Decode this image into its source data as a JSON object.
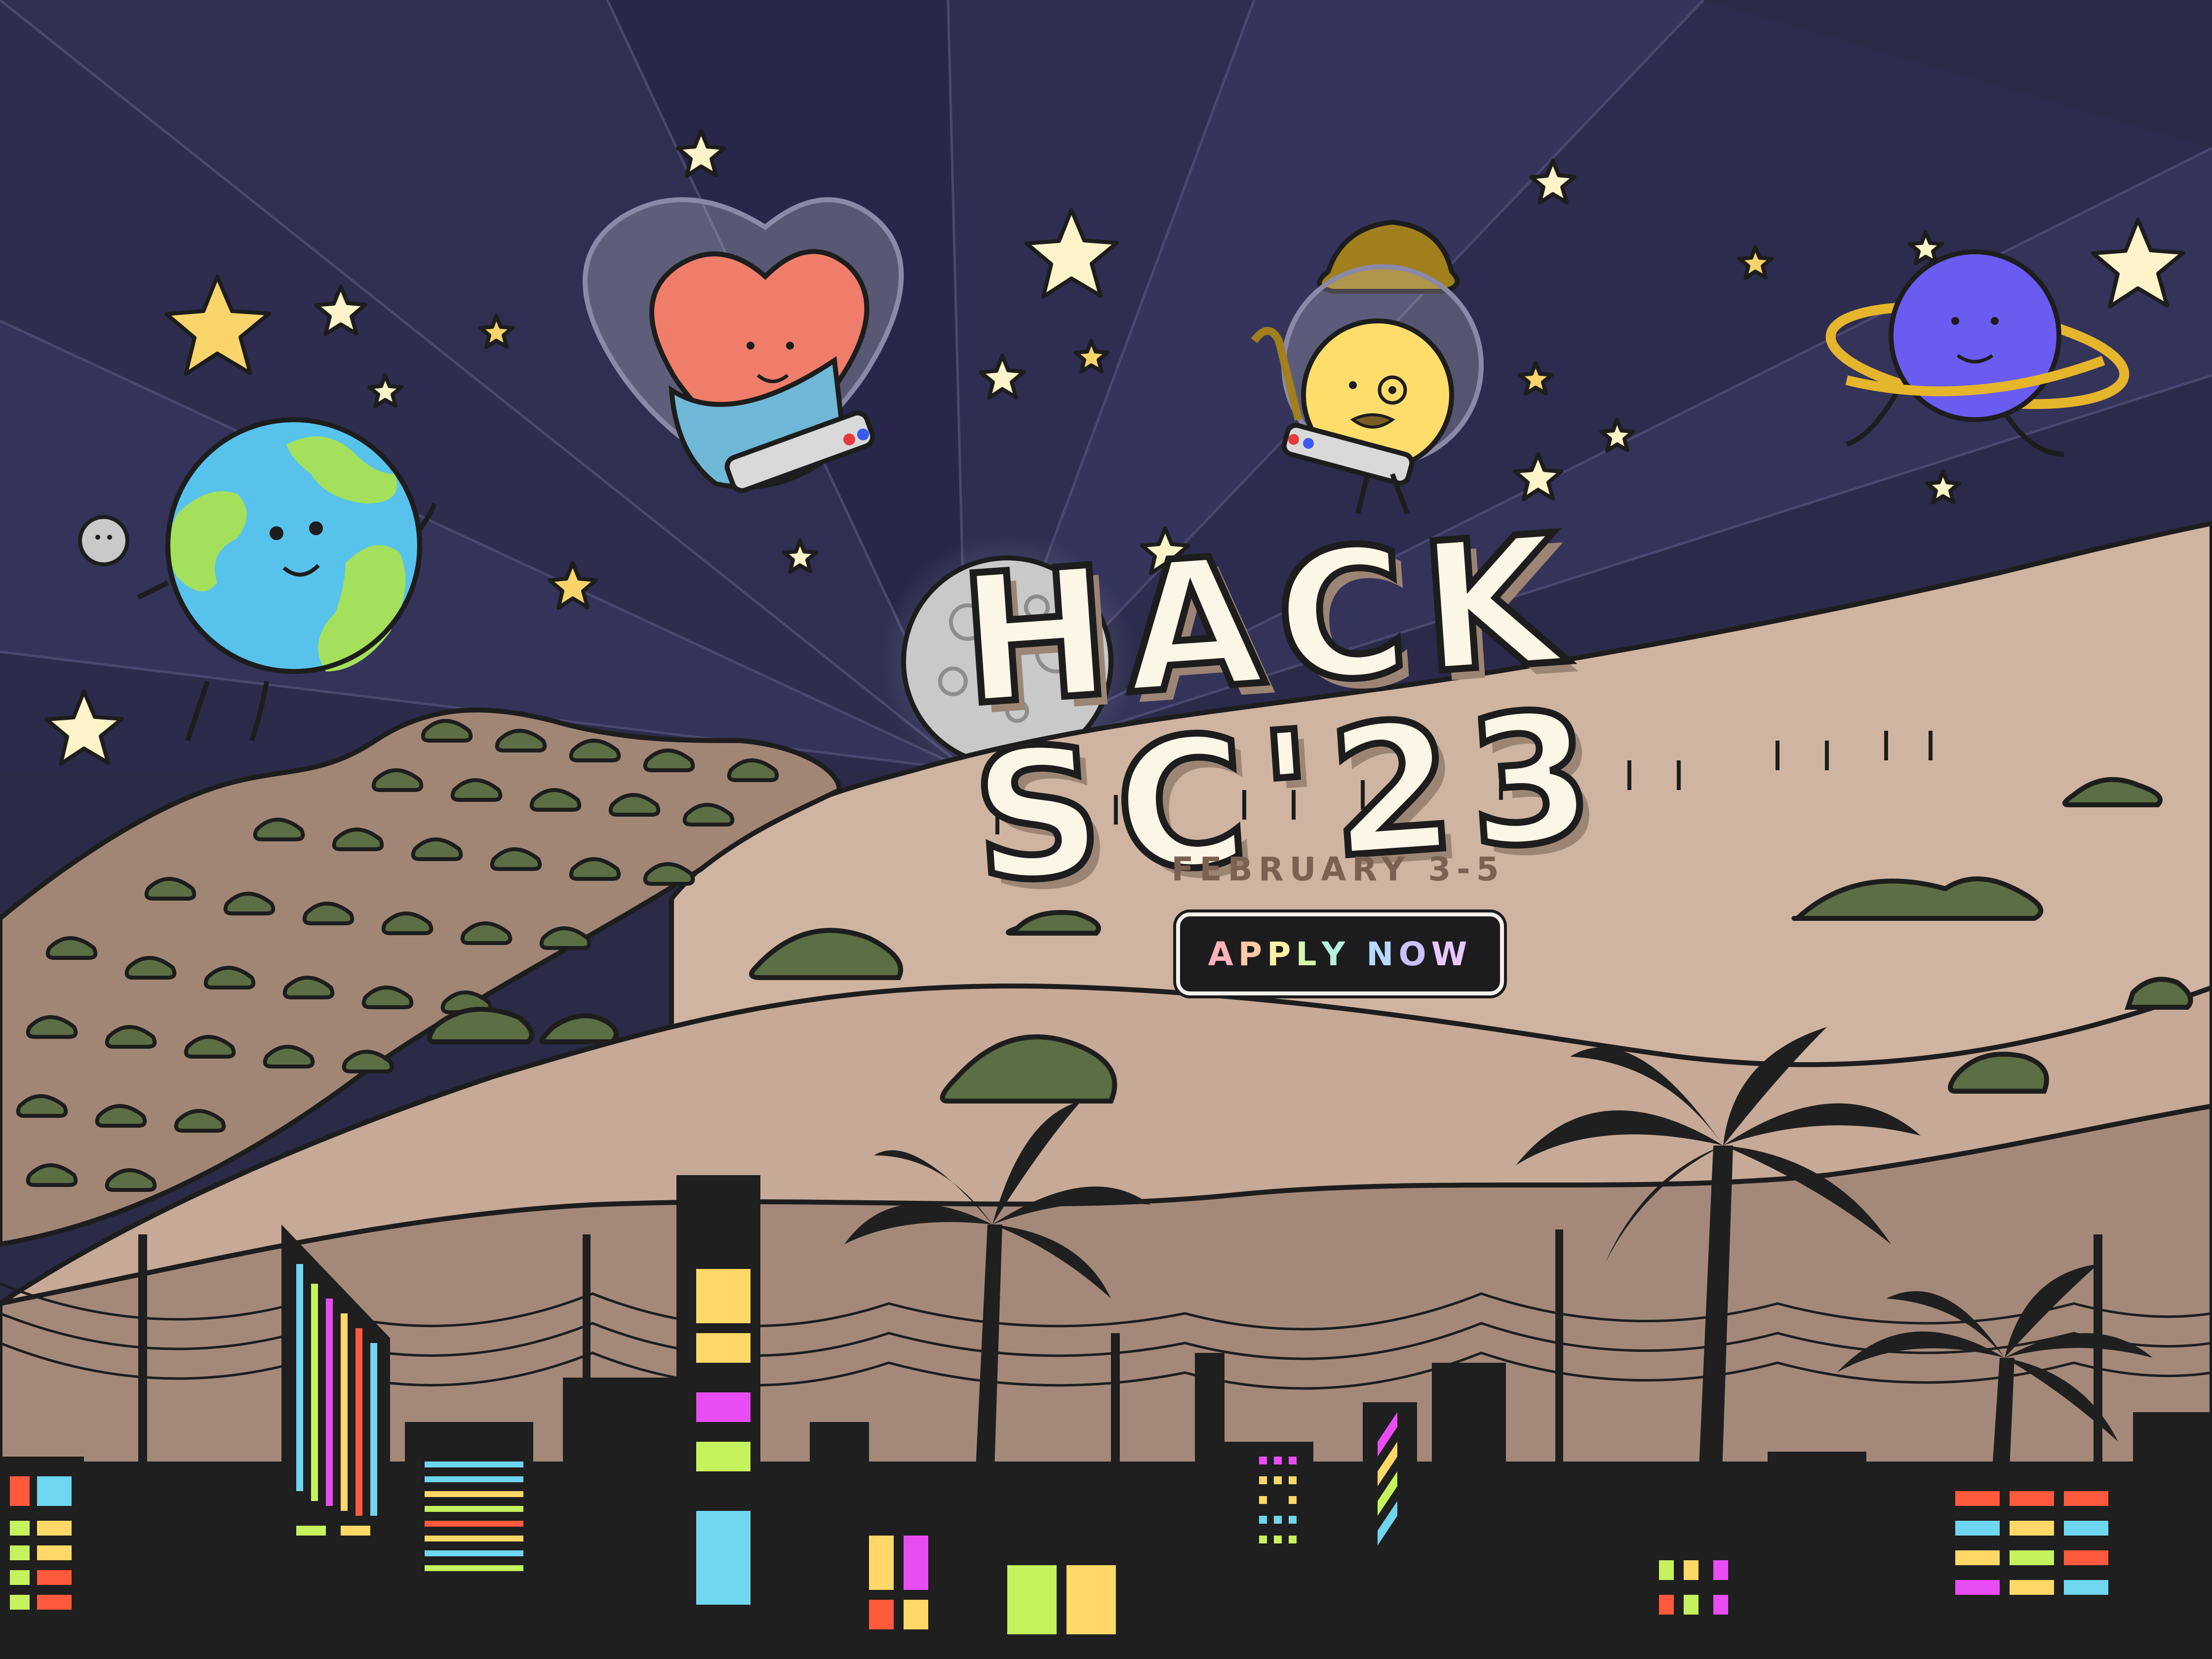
{
  "event": {
    "title": "HACK SC'23",
    "date": "FEBRUARY 3-5"
  },
  "cta": {
    "apply_label": "APPLY NOW"
  },
  "colors": {
    "sky": "#2b2a47",
    "ray_light": "#34335a",
    "ray_dark": "#24233f",
    "star": "#fff4c9",
    "star_gold": "#f8d46a",
    "hill_light": "#cfb4a1",
    "hill_mid": "#b89c8a",
    "hill_dark": "#a18676",
    "bush": "#5c6e44",
    "city": "#1f1f1f",
    "window_blue": "#6fd6ef",
    "window_yellow": "#ffd867",
    "window_green": "#c6f25d",
    "window_red": "#ff5a3c",
    "window_magenta": "#e84cf3",
    "heart": "#f07d6a",
    "earth_ocean": "#57c3ec",
    "earth_land": "#a4e05c",
    "planet_purple": "#6a5cf0",
    "ring_gold": "#e5b52b",
    "sun_yellow": "#ffdd6b",
    "moon_gray": "#c9c9c9",
    "hat_brown": "#a07f1c"
  },
  "icons": [
    "earth-mascot-icon",
    "heart-mascot-icon",
    "moon-mascot-icon",
    "planet-mascot-icon",
    "small-moon-icon",
    "star-icon",
    "palm-tree-icon"
  ]
}
